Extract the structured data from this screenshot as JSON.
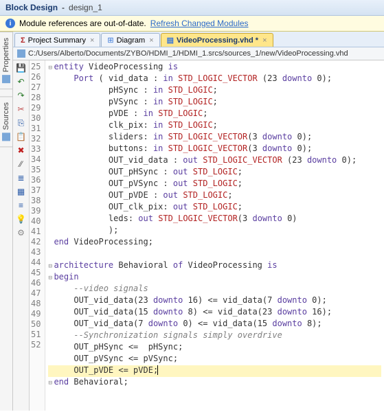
{
  "titlebar": {
    "label": "Block Design",
    "name": "design_1"
  },
  "warn": {
    "text": "Module references are out-of-date.",
    "link": "Refresh Changed Modules"
  },
  "sidetabs": [
    {
      "label": "Properties"
    },
    {
      "label": "Sources"
    }
  ],
  "tabs": [
    {
      "icon": "sigma",
      "label": "Project Summary",
      "active": false
    },
    {
      "icon": "diagram",
      "label": "Diagram",
      "active": false
    },
    {
      "icon": "file",
      "label": "VideoProcessing.vhd *",
      "active": true
    }
  ],
  "path": "C:/Users/Alberto/Documents/ZYBO/HDMI_1/HDMI_1.srcs/sources_1/new/VideoProcessing.vhd",
  "toolbar_icons": [
    "save",
    "undo",
    "redo",
    "cut",
    "copy",
    "paste",
    "delete",
    "separator",
    "find",
    "replace",
    "goto",
    "indent",
    "lightbulb",
    "settings"
  ],
  "first_line": 25,
  "cursor_line": 51,
  "code": [
    {
      "n": 25,
      "f": "-",
      "t": [
        [
          "kw",
          "entity"
        ],
        [
          "id",
          " VideoProcessing "
        ],
        [
          "kw",
          "is"
        ]
      ]
    },
    {
      "n": 26,
      "t": [
        [
          "id",
          "    "
        ],
        [
          "kw",
          "Port"
        ],
        [
          "id",
          " ( vid_data : "
        ],
        [
          "kw",
          "in"
        ],
        [
          "id",
          " "
        ],
        [
          "ty",
          "STD_LOGIC_VECTOR"
        ],
        [
          "id",
          " (23 "
        ],
        [
          "kw",
          "downto"
        ],
        [
          "id",
          " 0);"
        ]
      ]
    },
    {
      "n": 27,
      "t": [
        [
          "id",
          "           pHSync : "
        ],
        [
          "kw",
          "in"
        ],
        [
          "id",
          " "
        ],
        [
          "ty",
          "STD_LOGIC"
        ],
        [
          "id",
          ";"
        ]
      ]
    },
    {
      "n": 28,
      "t": [
        [
          "id",
          "           pVSync : "
        ],
        [
          "kw",
          "in"
        ],
        [
          "id",
          " "
        ],
        [
          "ty",
          "STD_LOGIC"
        ],
        [
          "id",
          ";"
        ]
      ]
    },
    {
      "n": 29,
      "t": [
        [
          "id",
          "           pVDE : "
        ],
        [
          "kw",
          "in"
        ],
        [
          "id",
          " "
        ],
        [
          "ty",
          "STD_LOGIC"
        ],
        [
          "id",
          ";"
        ]
      ]
    },
    {
      "n": 30,
      "t": [
        [
          "id",
          "           clk_pix: "
        ],
        [
          "kw",
          "in"
        ],
        [
          "id",
          " "
        ],
        [
          "ty",
          "STD_LOGIC"
        ],
        [
          "id",
          ";"
        ]
      ]
    },
    {
      "n": 31,
      "t": [
        [
          "id",
          "           sliders: "
        ],
        [
          "kw",
          "in"
        ],
        [
          "id",
          " "
        ],
        [
          "ty",
          "STD_LOGIC_VECTOR"
        ],
        [
          "id",
          "(3 "
        ],
        [
          "kw",
          "downto"
        ],
        [
          "id",
          " 0);"
        ]
      ]
    },
    {
      "n": 32,
      "t": [
        [
          "id",
          "           buttons: "
        ],
        [
          "kw",
          "in"
        ],
        [
          "id",
          " "
        ],
        [
          "ty",
          "STD_LOGIC_VECTOR"
        ],
        [
          "id",
          "(3 "
        ],
        [
          "kw",
          "downto"
        ],
        [
          "id",
          " 0);"
        ]
      ]
    },
    {
      "n": 33,
      "t": [
        [
          "id",
          "           OUT_vid_data : "
        ],
        [
          "kw",
          "out"
        ],
        [
          "id",
          " "
        ],
        [
          "ty",
          "STD_LOGIC_VECTOR"
        ],
        [
          "id",
          " (23 "
        ],
        [
          "kw",
          "downto"
        ],
        [
          "id",
          " 0);"
        ]
      ]
    },
    {
      "n": 34,
      "t": [
        [
          "id",
          "           OUT_pHSync : "
        ],
        [
          "kw",
          "out"
        ],
        [
          "id",
          " "
        ],
        [
          "ty",
          "STD_LOGIC"
        ],
        [
          "id",
          ";"
        ]
      ]
    },
    {
      "n": 35,
      "t": [
        [
          "id",
          "           OUT_pVSync : "
        ],
        [
          "kw",
          "out"
        ],
        [
          "id",
          " "
        ],
        [
          "ty",
          "STD_LOGIC"
        ],
        [
          "id",
          ";"
        ]
      ]
    },
    {
      "n": 36,
      "t": [
        [
          "id",
          "           OUT_pVDE : "
        ],
        [
          "kw",
          "out"
        ],
        [
          "id",
          " "
        ],
        [
          "ty",
          "STD_LOGIC"
        ],
        [
          "id",
          ";"
        ]
      ]
    },
    {
      "n": 37,
      "t": [
        [
          "id",
          "           OUT_clk_pix: "
        ],
        [
          "kw",
          "out"
        ],
        [
          "id",
          " "
        ],
        [
          "ty",
          "STD_LOGIC"
        ],
        [
          "id",
          ";"
        ]
      ]
    },
    {
      "n": 38,
      "t": [
        [
          "id",
          "           leds: "
        ],
        [
          "kw",
          "out"
        ],
        [
          "id",
          " "
        ],
        [
          "ty",
          "STD_LOGIC_VECTOR"
        ],
        [
          "id",
          "(3 "
        ],
        [
          "kw",
          "downto"
        ],
        [
          "id",
          " 0)"
        ]
      ]
    },
    {
      "n": 39,
      "t": [
        [
          "id",
          "           );"
        ]
      ]
    },
    {
      "n": 40,
      "t": [
        [
          "kw",
          "end"
        ],
        [
          "id",
          " VideoProcessing;"
        ]
      ]
    },
    {
      "n": 41,
      "t": [
        [
          "id",
          ""
        ]
      ]
    },
    {
      "n": 42,
      "f": "-",
      "t": [
        [
          "kw",
          "architecture"
        ],
        [
          "id",
          " Behavioral "
        ],
        [
          "kw",
          "of"
        ],
        [
          "id",
          " VideoProcessing "
        ],
        [
          "kw",
          "is"
        ]
      ]
    },
    {
      "n": 43,
      "f": "-",
      "t": [
        [
          "kw",
          "begin"
        ]
      ]
    },
    {
      "n": 44,
      "t": [
        [
          "id",
          "    "
        ],
        [
          "cm",
          "--video signals"
        ]
      ]
    },
    {
      "n": 45,
      "t": [
        [
          "id",
          "    OUT_vid_data(23 "
        ],
        [
          "kw",
          "downto"
        ],
        [
          "id",
          " 16) <= vid_data(7 "
        ],
        [
          "kw",
          "downto"
        ],
        [
          "id",
          " 0);"
        ]
      ]
    },
    {
      "n": 46,
      "t": [
        [
          "id",
          "    OUT_vid_data(15 "
        ],
        [
          "kw",
          "downto"
        ],
        [
          "id",
          " 8) <= vid_data(23 "
        ],
        [
          "kw",
          "downto"
        ],
        [
          "id",
          " 16);"
        ]
      ]
    },
    {
      "n": 47,
      "t": [
        [
          "id",
          "    OUT_vid_data(7 "
        ],
        [
          "kw",
          "downto"
        ],
        [
          "id",
          " 0) <= vid_data(15 "
        ],
        [
          "kw",
          "downto"
        ],
        [
          "id",
          " 8);"
        ]
      ]
    },
    {
      "n": 48,
      "t": [
        [
          "id",
          "    "
        ],
        [
          "cm",
          "--Synchronization signals simply overdrive"
        ]
      ]
    },
    {
      "n": 49,
      "t": [
        [
          "id",
          "    OUT_pHSync <=  pHSync;"
        ]
      ]
    },
    {
      "n": 50,
      "t": [
        [
          "id",
          "    OUT_pVSync <= pVSync;"
        ]
      ]
    },
    {
      "n": 51,
      "hl": true,
      "t": [
        [
          "id",
          "    OUT_pVDE <= pVDE;"
        ]
      ]
    },
    {
      "n": 52,
      "f": "-",
      "t": [
        [
          "kw",
          "end"
        ],
        [
          "id",
          " Behavioral;"
        ]
      ]
    }
  ]
}
